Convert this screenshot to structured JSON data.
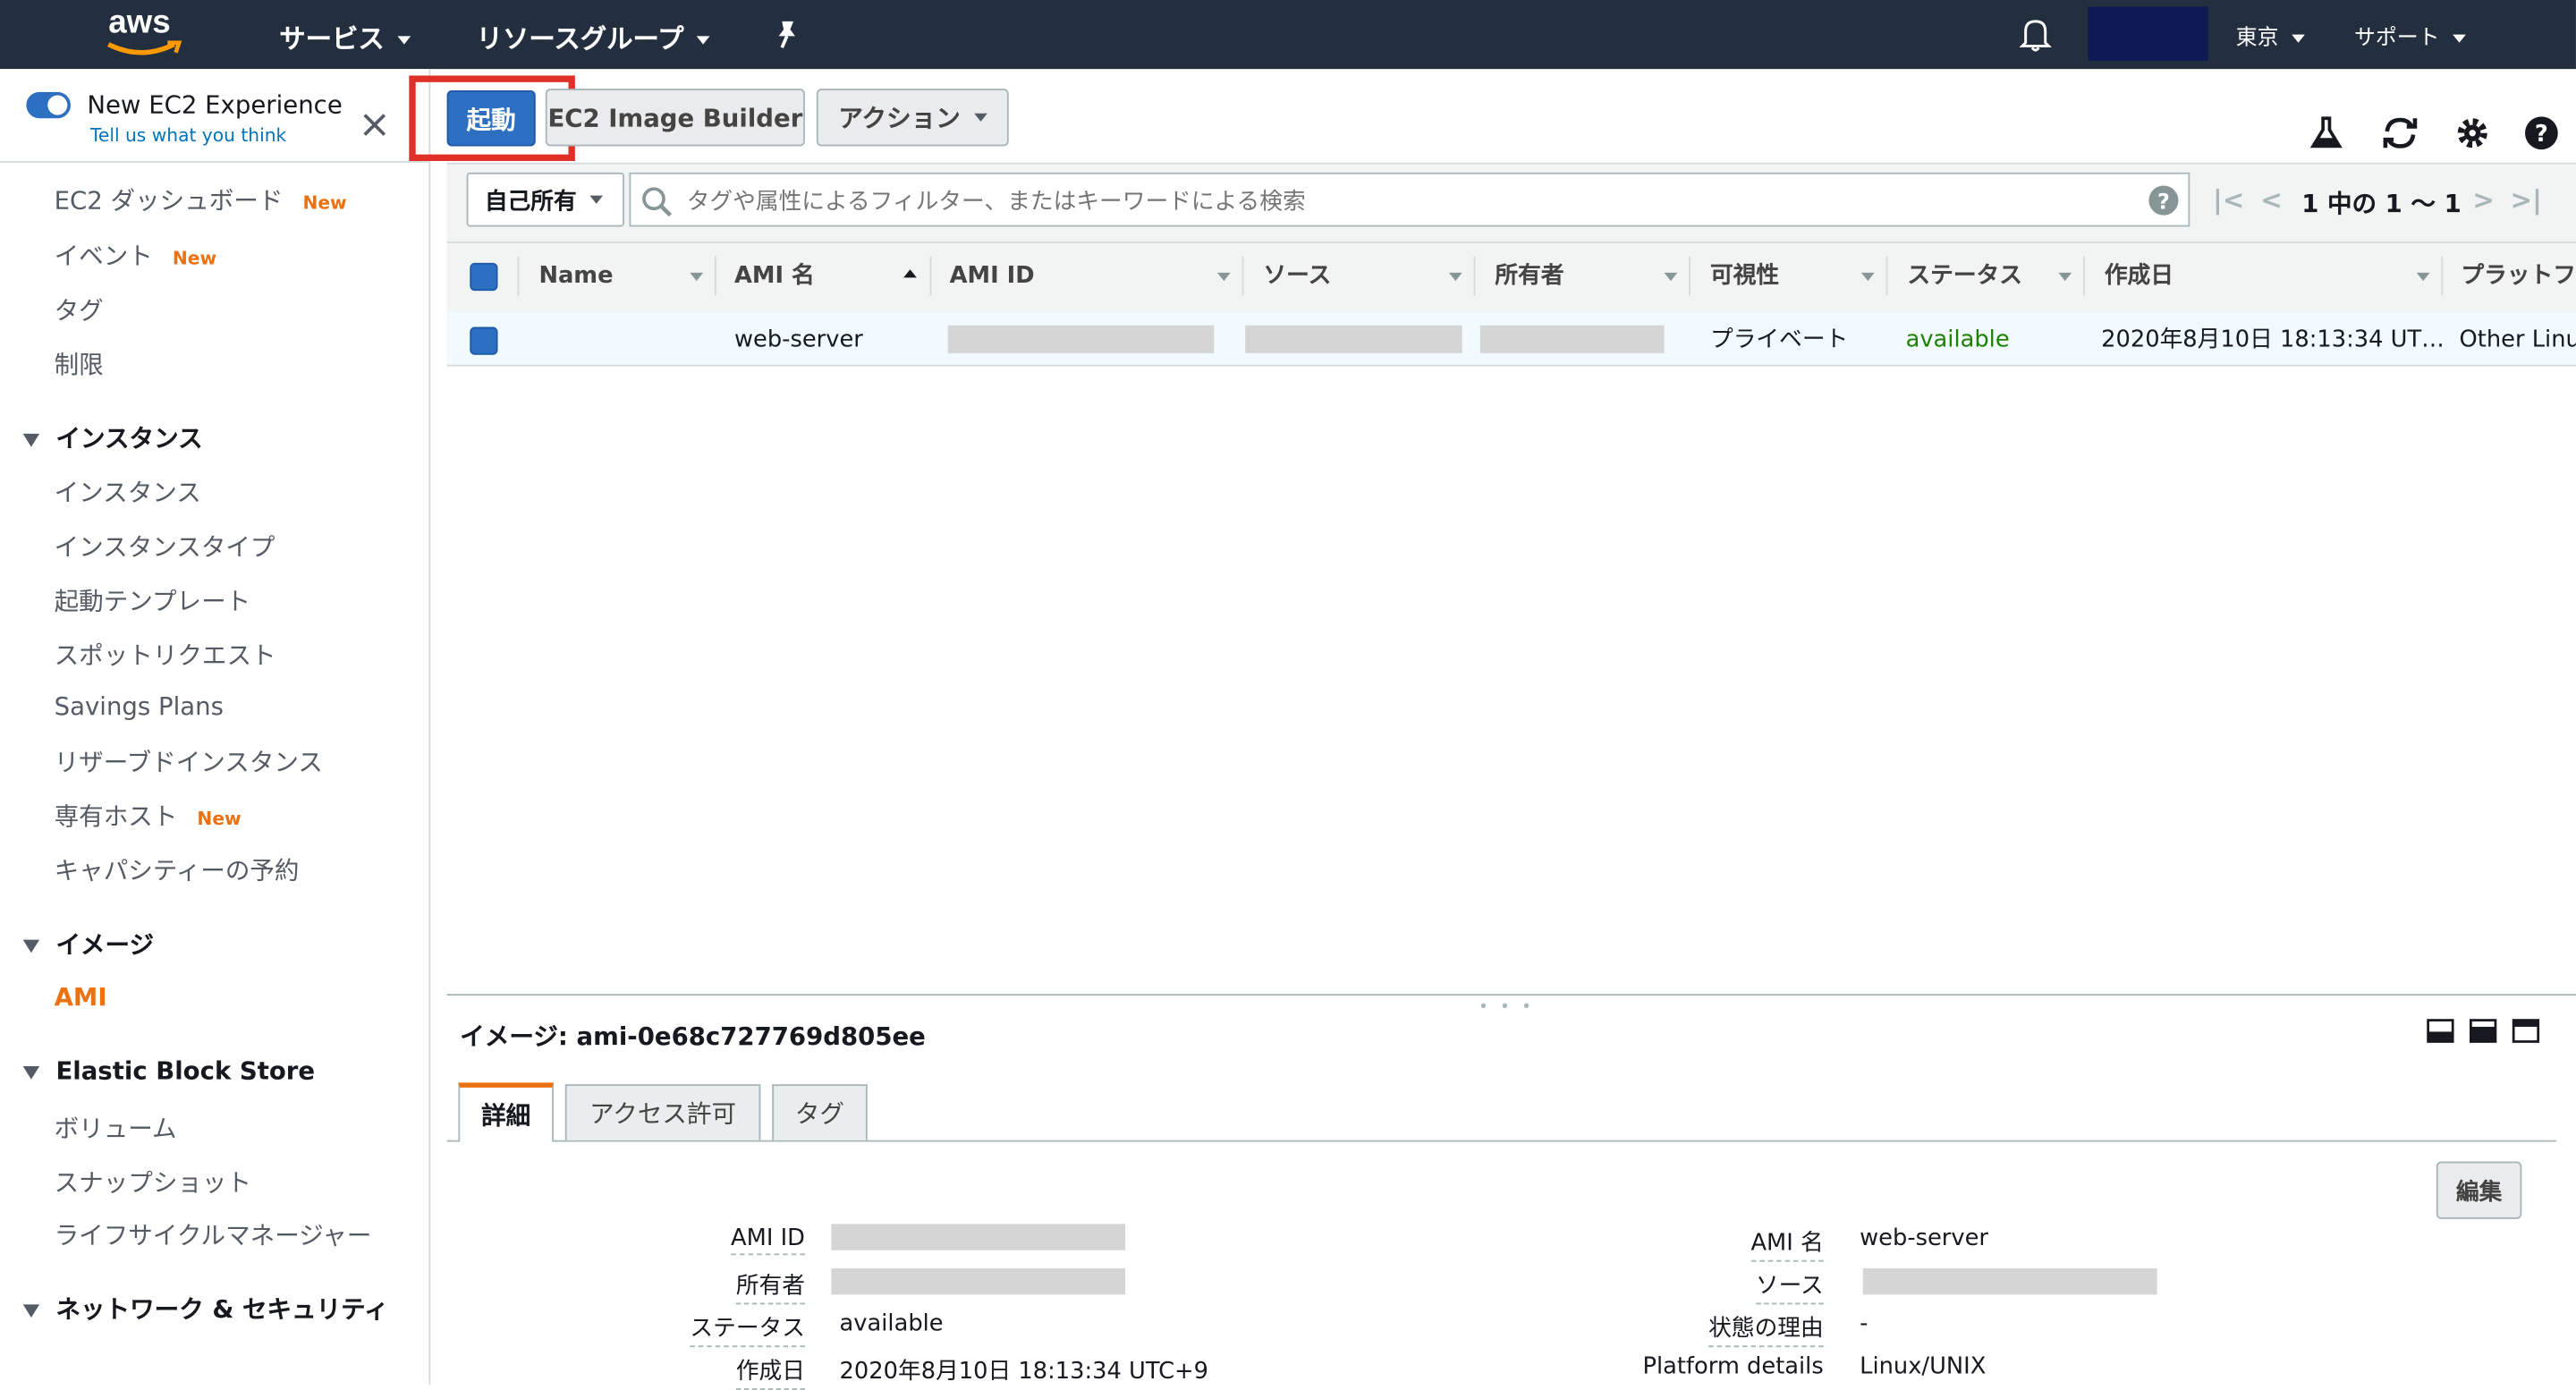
{
  "nav": {
    "logo": "aws",
    "services": "サービス",
    "resource_groups": "リソースグループ",
    "region": "東京",
    "support": "サポート"
  },
  "sidebar": {
    "toggle_title": "New EC2 Experience",
    "toggle_sub": "Tell us what you think",
    "new_label": "New",
    "items_top": [
      {
        "label": "EC2 ダッシュボード",
        "new": true
      },
      {
        "label": "イベント",
        "new": true
      },
      {
        "label": "タグ",
        "new": false
      },
      {
        "label": "制限",
        "new": false
      }
    ],
    "sections": {
      "instances": "インスタンス",
      "images": "イメージ",
      "ebs": "Elastic Block Store",
      "network": "ネットワーク & セキュリティ"
    },
    "instances_items": [
      "インスタンス",
      "インスタンスタイプ",
      "起動テンプレート",
      "スポットリクエスト",
      "Savings Plans",
      "リザーブドインスタンス",
      "専有ホスト",
      "キャパシティーの予約"
    ],
    "images_items": [
      "AMI"
    ],
    "ebs_items": [
      "ボリューム",
      "スナップショット",
      "ライフサイクルマネージャー"
    ]
  },
  "toolbar": {
    "launch": "起動",
    "image_builder": "EC2 Image Builder",
    "actions": "アクション"
  },
  "filter": {
    "owner": "自己所有",
    "placeholder": "タグや属性によるフィルター、またはキーワードによる検索",
    "pagination": "1 中の 1 〜 1"
  },
  "table": {
    "headers": [
      "Name",
      "AMI 名",
      "AMI ID",
      "ソース",
      "所有者",
      "可視性",
      "ステータス",
      "作成日",
      "プラットフ"
    ],
    "row": {
      "name": "",
      "ami_name": "web-server",
      "visibility": "プライベート",
      "status": "available",
      "created": "2020年8月10日 18:13:34 UT…",
      "platform": "Other Linux"
    }
  },
  "detail": {
    "title": "イメージ: ami-0e68c727769d805ee",
    "tabs": [
      "詳細",
      "アクセス許可",
      "タグ"
    ],
    "edit": "編集",
    "left": [
      {
        "label": "AMI ID",
        "value": ""
      },
      {
        "label": "所有者",
        "value": ""
      },
      {
        "label": "ステータス",
        "value": "available"
      },
      {
        "label": "作成日",
        "value": "2020年8月10日 18:13:34 UTC+9"
      }
    ],
    "right": [
      {
        "label": "AMI 名",
        "value": "web-server"
      },
      {
        "label": "ソース",
        "value": ""
      },
      {
        "label": "状態の理由",
        "value": "-"
      },
      {
        "label": "Platform details",
        "value": "Linux/UNIX"
      }
    ]
  },
  "colors": {
    "nav_bg": "#232f3e",
    "primary": "#2d6fc1",
    "highlight": "#e02f26",
    "accent_orange": "#ec7211",
    "status_green": "#1d8102"
  }
}
